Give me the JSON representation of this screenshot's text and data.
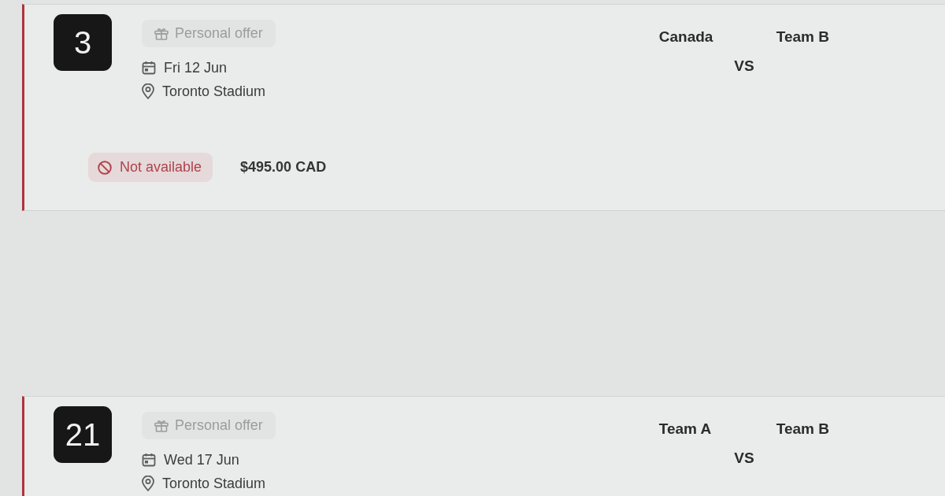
{
  "matches": [
    {
      "number": "3",
      "offer": {
        "label": "Personal offer"
      },
      "date": "Fri 12 Jun",
      "venue": "Toronto Stadium",
      "home_team": "Canada",
      "versus": "VS",
      "away_team": "Team B",
      "availability": {
        "label": "Not available",
        "kind": "unavailable"
      },
      "price": "$495.00 CAD"
    },
    {
      "number": "21",
      "offer": {
        "label": "Personal offer"
      },
      "date": "Wed 17 Jun",
      "venue": "Toronto Stadium",
      "home_team": "Team A",
      "versus": "VS",
      "away_team": "Team B"
    }
  ]
}
